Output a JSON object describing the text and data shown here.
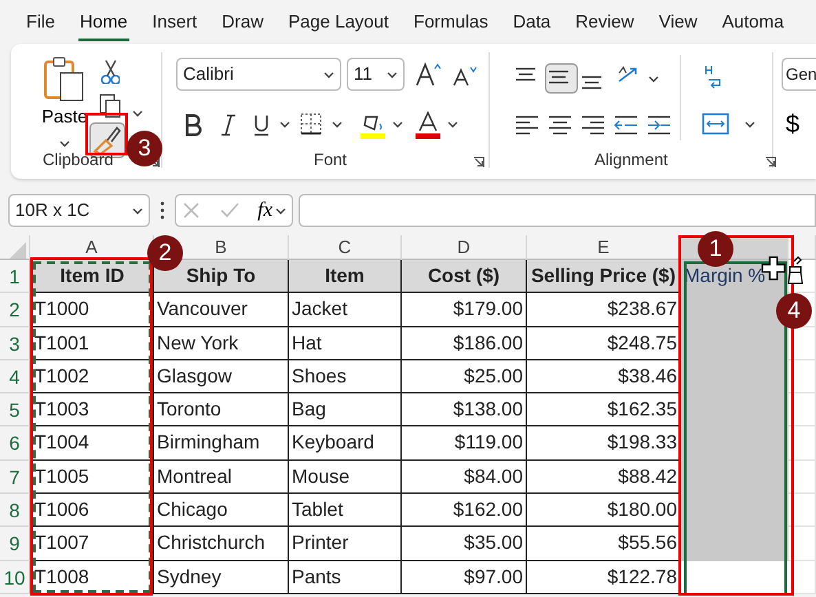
{
  "tabs": [
    {
      "label": "File",
      "selected": false
    },
    {
      "label": "Home",
      "selected": true
    },
    {
      "label": "Insert",
      "selected": false
    },
    {
      "label": "Draw",
      "selected": false
    },
    {
      "label": "Page Layout",
      "selected": false
    },
    {
      "label": "Formulas",
      "selected": false
    },
    {
      "label": "Data",
      "selected": false
    },
    {
      "label": "Review",
      "selected": false
    },
    {
      "label": "View",
      "selected": false
    },
    {
      "label": "Automa",
      "selected": false
    }
  ],
  "clipboard": {
    "paste_label": "Paste",
    "format_painter_selected": true,
    "group_label": "Clipboard"
  },
  "font": {
    "name": "Calibri",
    "size": "11",
    "group_label": "Font"
  },
  "alignment": {
    "vertical": [
      {
        "selected": false
      },
      {
        "selected": true
      },
      {
        "selected": false
      }
    ],
    "group_label": "Alignment"
  },
  "number": {
    "format": "Gen",
    "currency": "$"
  },
  "formula_bar": {
    "name_box": "10R x 1C",
    "function_label": "fx"
  },
  "sheet": {
    "column_letters": [
      "A",
      "B",
      "C",
      "D",
      "E"
    ],
    "row_numbers": [
      "1",
      "2",
      "3",
      "4",
      "5",
      "6",
      "7",
      "8",
      "9",
      "10"
    ],
    "header": [
      "Item ID",
      "Ship To",
      "Item",
      "Cost ($)",
      "Selling Price ($)",
      "Margin %"
    ],
    "rows": [
      [
        "T1000",
        "Vancouver",
        "Jacket",
        "$179.00",
        "$238.67"
      ],
      [
        "T1001",
        "New York",
        "Hat",
        "$186.00",
        "$248.75"
      ],
      [
        "T1002",
        "Glasgow",
        "Shoes",
        "$25.00",
        "$38.46"
      ],
      [
        "T1003",
        "Toronto",
        "Bag",
        "$138.00",
        "$162.35"
      ],
      [
        "T1004",
        "Birmingham",
        "Keyboard",
        "$119.00",
        "$198.33"
      ],
      [
        "T1005",
        "Montreal",
        "Mouse",
        "$84.00",
        "$88.42"
      ],
      [
        "T1006",
        "Chicago",
        "Tablet",
        "$162.00",
        "$180.00"
      ],
      [
        "T1007",
        "Christchurch",
        "Printer",
        "$35.00",
        "$55.56"
      ],
      [
        "T1008",
        "Sydney",
        "Pants",
        "$97.00",
        "$122.78"
      ]
    ],
    "margin_cells": [
      {
        "shaded": true
      },
      {
        "shaded": true
      },
      {
        "shaded": true
      },
      {
        "shaded": true
      },
      {
        "shaded": true
      },
      {
        "shaded": true
      },
      {
        "shaded": true
      },
      {
        "shaded": true
      },
      {
        "shaded": false
      }
    ]
  },
  "callouts": [
    "1",
    "2",
    "3",
    "4"
  ]
}
